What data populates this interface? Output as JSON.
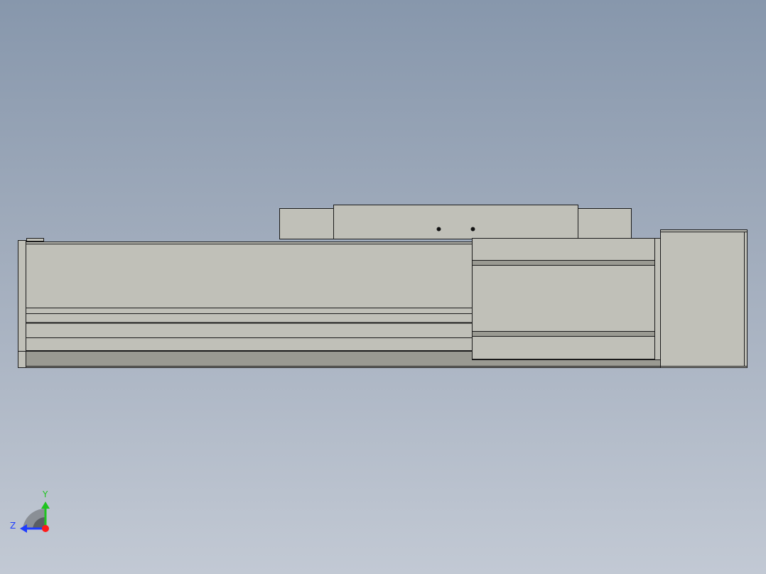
{
  "viewport": {
    "background_top": "#8797ac",
    "background_bottom": "#c2c9d4"
  },
  "model": {
    "name": "linear-actuator-side-view",
    "body_color": "#c0c0b8",
    "shade_color": "#9a9a92",
    "edge_color": "#1a1a1a"
  },
  "triad": {
    "x_label": "",
    "y_label": "Y",
    "z_label": "Z",
    "y_color": "#1fc41f",
    "z_color": "#1e3cff",
    "origin_color": "#ff1a1a"
  }
}
